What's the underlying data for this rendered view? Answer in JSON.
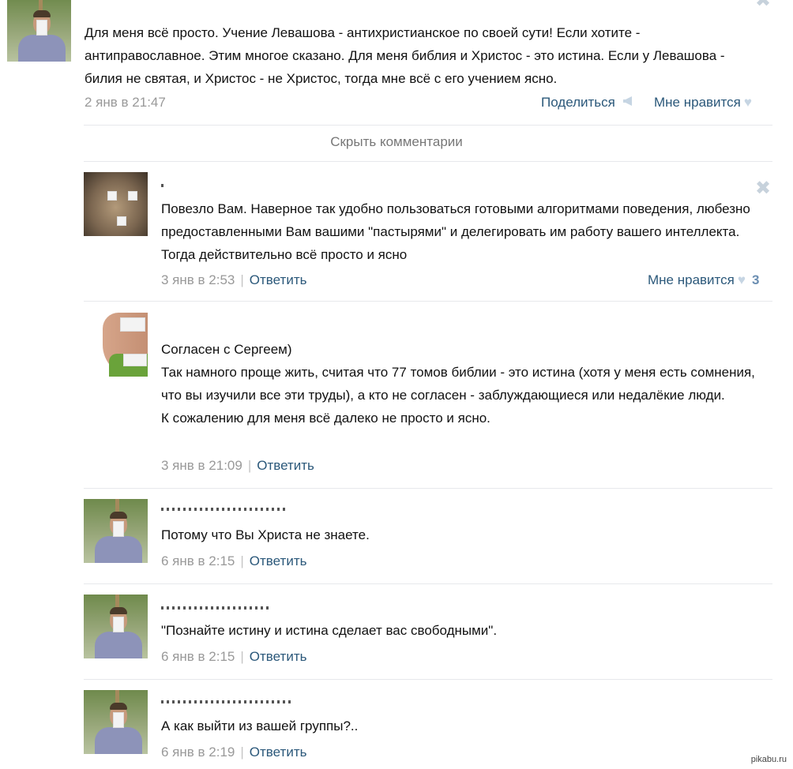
{
  "post": {
    "text": "Для меня всё просто. Учение Левашова - антихристианское по своей сути! Если хотите - антиправославное. Этим многое сказано. Для меня библия и Христос - это истина. Если у Левашова - билия не святая, и Христос - не Христос, тогда мне всё с его учением ясно.",
    "time": "2 янв в 21:47",
    "share_label": "Поделиться",
    "like_label": "Мне нравится",
    "share_icon": "megaphone-icon",
    "like_icon": "heart-icon",
    "close_icon": "close-icon"
  },
  "hide_comments_label": "Скрыть комментарии",
  "comments": [
    {
      "text_lines": [
        "Повезло Вам. Наверное так удобно пользоваться готовыми алгоритмами поведения, любезно предоставленными Вам вашими \"пастырями\" и делегировать им работу вашего интеллекта. Тогда действительно всё просто и ясно"
      ],
      "time": "3 янв в 2:53",
      "reply_label": "Ответить",
      "like_label": "Мне нравится",
      "like_count": "3"
    },
    {
      "text_lines": [
        "Согласен с Сергеем)",
        "Так намного проще жить, считая что 77 томов библии - это истина (хотя у меня есть сомнения, что вы изучили все эти труды), а кто не согласен - заблуждающиеся или недалёкие люди.",
        "К сожалению для меня всё далеко не просто и ясно."
      ],
      "time": "3 янв в 21:09",
      "reply_label": "Ответить"
    },
    {
      "text_lines": [
        "Потому что Вы Христа не знаете."
      ],
      "time": "6 янв в 2:15",
      "reply_label": "Ответить"
    },
    {
      "text_lines": [
        "\"Познайте истину и истина сделает вас свободными\"."
      ],
      "time": "6 янв в 2:15",
      "reply_label": "Ответить"
    },
    {
      "text_lines": [
        "А как выйти из вашей группы?.."
      ],
      "time": "6 янв в 2:19",
      "reply_label": "Ответить"
    }
  ],
  "watermark": "pikabu.ru",
  "colors": {
    "link": "#2b587a",
    "meta": "#999999",
    "divider": "#e7e8ec",
    "heart": "#c6d5e3"
  }
}
